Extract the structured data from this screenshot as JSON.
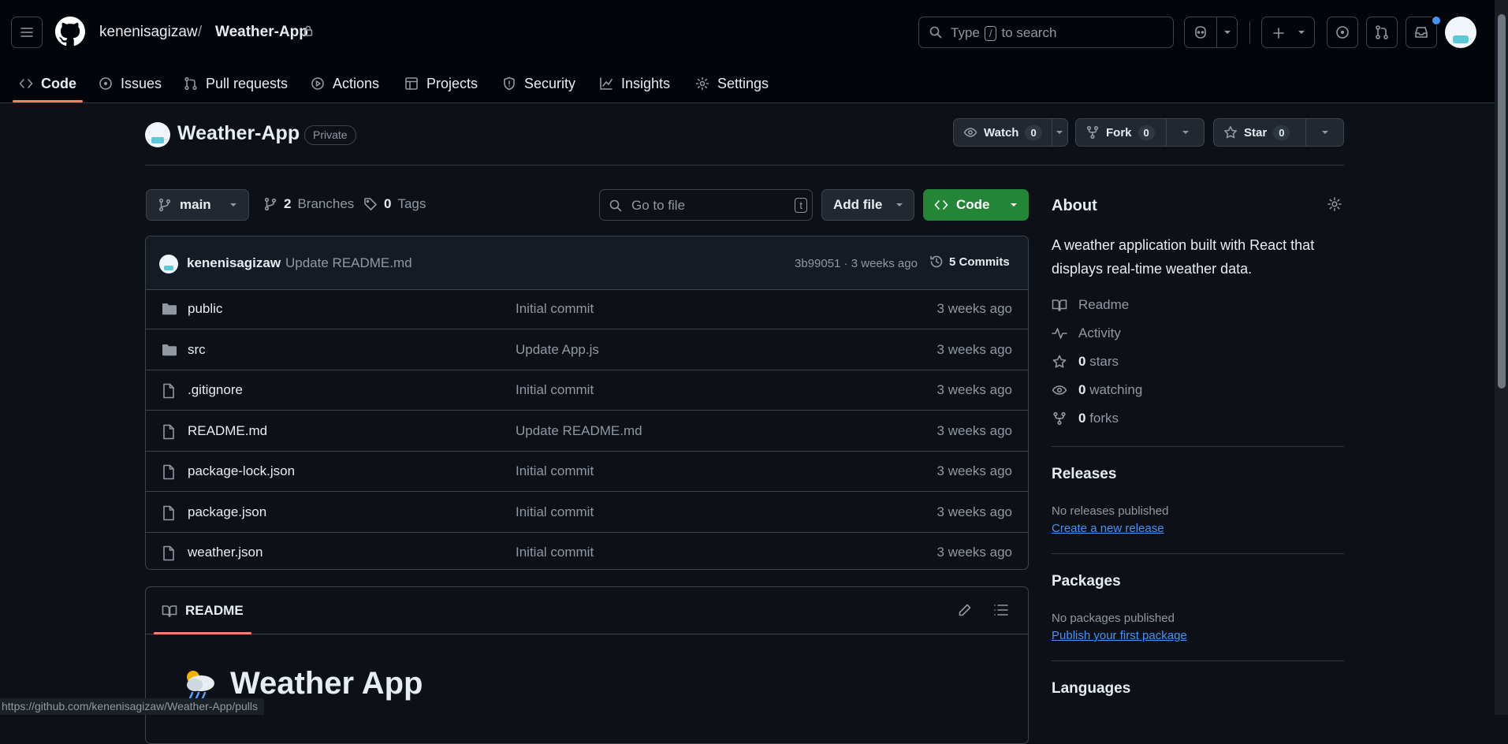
{
  "header": {
    "owner": "kenenisagizaw",
    "separator": "/",
    "repo": "Weather-App",
    "search_placeholder": "to search",
    "search_prefix": "Type",
    "search_key": "/"
  },
  "tabs": [
    {
      "label": "Code",
      "icon": "code-icon"
    },
    {
      "label": "Issues",
      "icon": "issue-icon"
    },
    {
      "label": "Pull requests",
      "icon": "pull-request-icon"
    },
    {
      "label": "Actions",
      "icon": "play-icon"
    },
    {
      "label": "Projects",
      "icon": "table-icon"
    },
    {
      "label": "Security",
      "icon": "shield-icon"
    },
    {
      "label": "Insights",
      "icon": "graph-icon"
    },
    {
      "label": "Settings",
      "icon": "gear-icon"
    }
  ],
  "repo": {
    "title": "Weather-App",
    "visibility": "Private",
    "watch_label": "Watch",
    "watch_count": "0",
    "fork_label": "Fork",
    "fork_count": "0",
    "star_label": "Star",
    "star_count": "0"
  },
  "branchbar": {
    "branch": "main",
    "branches_count": "2",
    "branches_label": "Branches",
    "tags_count": "0",
    "tags_label": "Tags",
    "goto_placeholder": "Go to file",
    "goto_key": "t",
    "add_file": "Add file",
    "code": "Code"
  },
  "commit": {
    "author": "kenenisagizaw",
    "message": "Update README.md",
    "hash_time": "3b99051 · 3 weeks ago",
    "commits": "5 Commits"
  },
  "files": [
    {
      "name": "public",
      "type": "folder",
      "message": "Initial commit",
      "time": "3 weeks ago"
    },
    {
      "name": "src",
      "type": "folder",
      "message": "Update App.js",
      "time": "3 weeks ago"
    },
    {
      "name": ".gitignore",
      "type": "file",
      "message": "Initial commit",
      "time": "3 weeks ago"
    },
    {
      "name": "README.md",
      "type": "file",
      "message": "Update README.md",
      "time": "3 weeks ago"
    },
    {
      "name": "package-lock.json",
      "type": "file",
      "message": "Initial commit",
      "time": "3 weeks ago"
    },
    {
      "name": "package.json",
      "type": "file",
      "message": "Initial commit",
      "time": "3 weeks ago"
    },
    {
      "name": "weather.json",
      "type": "file",
      "message": "Initial commit",
      "time": "3 weeks ago"
    }
  ],
  "readme": {
    "tab": "README",
    "heading": "Weather App"
  },
  "about": {
    "title": "About",
    "description": "A weather application built with React that displays real-time weather data.",
    "readme": "Readme",
    "activity": "Activity",
    "stars_count": "0",
    "stars_label": "stars",
    "watching_count": "0",
    "watching_label": "watching",
    "forks_count": "0",
    "forks_label": "forks"
  },
  "releases": {
    "title": "Releases",
    "empty": "No releases published",
    "link": "Create a new release"
  },
  "packages": {
    "title": "Packages",
    "empty": "No packages published",
    "link": "Publish your first package"
  },
  "languages": {
    "title": "Languages"
  },
  "status_url": "https://github.com/kenenisagizaw/Weather-App/pulls",
  "colors": {
    "background": "#0d1117",
    "header": "#010409",
    "accent_tab": "#f78166",
    "code_button": "#238636",
    "link": "#4493f8"
  }
}
